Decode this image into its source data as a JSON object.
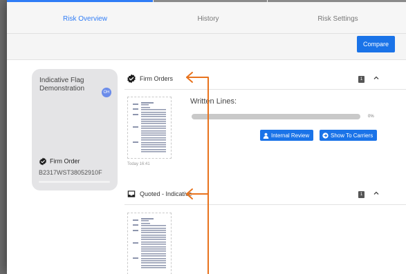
{
  "tabs": [
    {
      "label": "Risk Overview",
      "active": true
    },
    {
      "label": "History",
      "active": false
    },
    {
      "label": "Risk Settings",
      "active": false
    }
  ],
  "toolbar": {
    "compare_label": "Compare"
  },
  "card": {
    "title": "Indicative Flag Demonstration",
    "badge": "OH",
    "order_label": "Firm Order",
    "reference": "B2317WST38052910F"
  },
  "sections": {
    "firm_orders": {
      "title": "Firm Orders",
      "count": "1"
    },
    "quoted": {
      "title": "Quoted - Indicative",
      "count": "1"
    }
  },
  "document": {
    "timestamp": "Today 16:41"
  },
  "written_lines": {
    "label": "Written Lines:",
    "percent_text": "0%",
    "progress": 0
  },
  "actions": {
    "internal_review": "Internal Review",
    "show_to_carriers": "Show To Carriers"
  },
  "colors": {
    "accent": "#1a73e8",
    "annotation_arrow": "#e8721c"
  },
  "icons": [
    "verified-badge-icon",
    "inbox-tray-icon",
    "chevron-up-icon",
    "user-icon",
    "arrow-right-circle-icon"
  ]
}
